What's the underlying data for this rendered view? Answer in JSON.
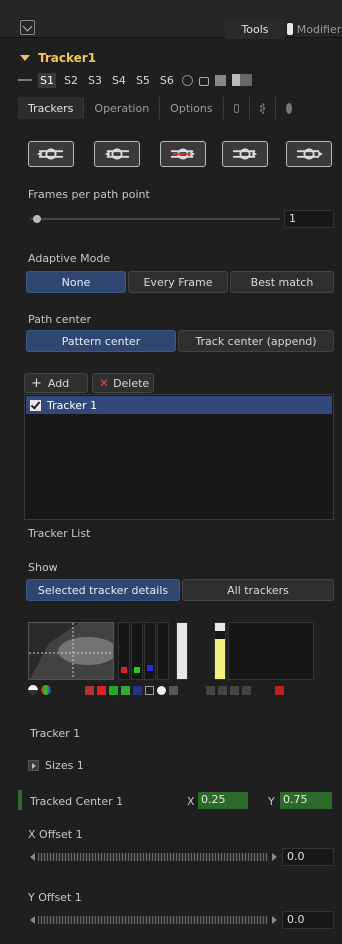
{
  "header": {
    "tab_tools": "Tools",
    "tab_modifiers": "Modifiers"
  },
  "tool": {
    "title": "Tracker1"
  },
  "stack_slots": [
    "S1",
    "S2",
    "S3",
    "S4",
    "S5",
    "S6"
  ],
  "subtabs": [
    "Trackers",
    "Operation",
    "Options"
  ],
  "frames_per_path": {
    "label": "Frames per path point",
    "value": "1"
  },
  "adaptive_mode": {
    "label": "Adaptive Mode",
    "options": [
      "None",
      "Every Frame",
      "Best match"
    ],
    "selected": "None"
  },
  "path_center": {
    "label": "Path center",
    "options": [
      "Pattern center",
      "Track center (append)"
    ],
    "selected": "Pattern center"
  },
  "list_controls": {
    "add": "Add",
    "delete": "Delete"
  },
  "tracker_list": {
    "items": [
      "Tracker 1"
    ],
    "caption": "Tracker List"
  },
  "show": {
    "label": "Show",
    "options": [
      "Selected tracker details",
      "All trackers"
    ],
    "selected": "Selected tracker details"
  },
  "preview": {
    "tracker_name": "Tracker 1"
  },
  "sizes": {
    "label": "Sizes 1"
  },
  "tracked_center": {
    "label": "Tracked Center 1",
    "x_label": "X",
    "x_value": "0.25",
    "y_label": "Y",
    "y_value": "0.75"
  },
  "x_offset": {
    "label": "X Offset 1",
    "value": "0.0"
  },
  "y_offset": {
    "label": "Y Offset 1",
    "value": "0.0"
  },
  "colors": {
    "accent": "#2f4670",
    "title": "#f0c654",
    "green_field": "#2b6a2b"
  }
}
